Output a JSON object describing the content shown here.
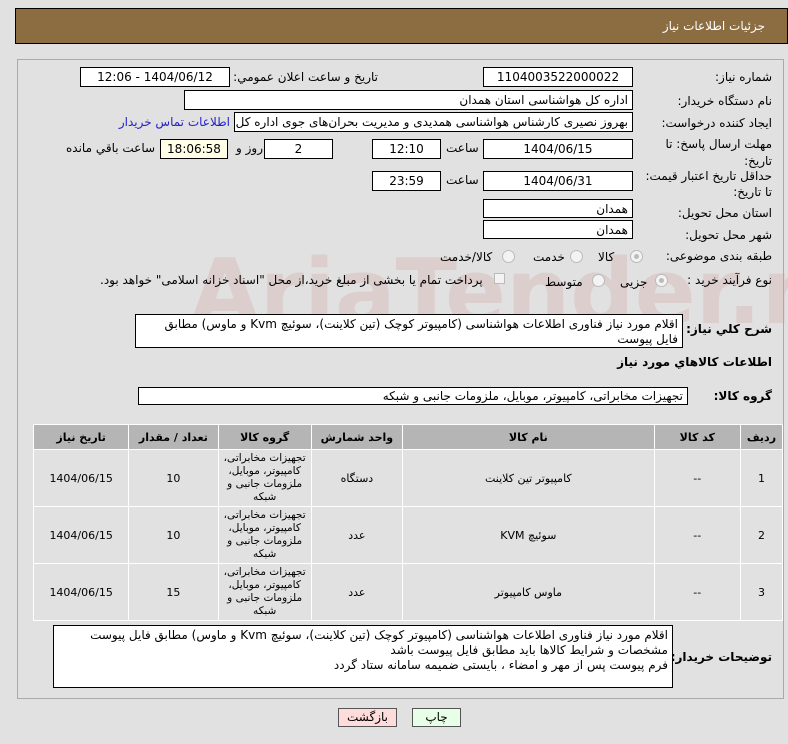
{
  "header": {
    "title": "جزئیات اطلاعات نیاز"
  },
  "form": {
    "need_number_label": "شماره نیاز:",
    "need_number": "1104003522000022",
    "announce_label": "تاریخ و ساعت اعلان عمومي:",
    "announce_value": "1404/06/12 - 12:06",
    "buyer_org_label": "نام دستگاه خریدار:",
    "buyer_org": "اداره کل هواشناسی استان همدان",
    "creator_label": "ایجاد کننده درخواست:",
    "creator": "بهروز نصیری کارشناس هواشناسی همدیدی و مدیریت بحران‌های جوی  اداره کل",
    "contact_link": "اطلاعات تماس خریدار",
    "deadline_label": "مهلت ارسال پاسخ: تا تاریخ:",
    "deadline_date": "1404/06/15",
    "time_label": "ساعت",
    "deadline_time": "12:10",
    "days": "2",
    "days_label": "روز و",
    "remaining": "18:06:58",
    "remaining_label": "ساعت باقي مانده",
    "validity_label": "حداقل تاریخ اعتبار قیمت: تا تاریخ:",
    "validity_date": "1404/06/31",
    "validity_time": "23:59",
    "province_label": "استان محل تحویل:",
    "province": "همدان",
    "city_label": "شهر محل تحویل:",
    "city": "همدان",
    "category_label": "طبقه بندی موضوعی:",
    "category_options": [
      "کالا",
      "خدمت",
      "کالا/خدمت"
    ],
    "process_label": "نوع فرآیند خرید :",
    "process_options": [
      "جزیی",
      "متوسط"
    ],
    "payment_note": "پرداخت تمام یا بخشی از مبلغ خرید،از محل \"اسناد خزانه اسلامی\" خواهد بود.",
    "description_label": "شرح كلي نياز:",
    "description": "اقلام مورد نیاز فناوری اطلاعات هواشناسی (کامپیوتر کوچک (تین کلاینت)، سوئیچ Kvm و ماوس) مطابق فایل پیوست"
  },
  "goods": {
    "section_title": "اطلاعات كالاهاي مورد نياز",
    "group_label": "گروه کالا:",
    "group": "تجهیزات مخابراتی، کامپیوتر، موبایل، ملزومات جانبی و شبکه",
    "columns": [
      "ردیف",
      "کد کالا",
      "نام کالا",
      "واحد شمارش",
      "گروه کالا",
      "تعداد / مقدار",
      "تاریخ نیاز"
    ],
    "rows": [
      {
        "idx": "1",
        "code": "--",
        "name": "کامپیوتر تین کلاینت",
        "unit": "دستگاه",
        "group": "تجهیزات مخابراتی، کامپیوتر، موبایل، ملزومات جانبی و شبکه",
        "qty": "10",
        "date": "1404/06/15"
      },
      {
        "idx": "2",
        "code": "--",
        "name": "سوئیچ KVM",
        "unit": "عدد",
        "group": "تجهیزات مخابراتی، کامپیوتر، موبایل، ملزومات جانبی و شبکه",
        "qty": "10",
        "date": "1404/06/15"
      },
      {
        "idx": "3",
        "code": "--",
        "name": "ماوس کامپیوتر",
        "unit": "عدد",
        "group": "تجهیزات مخابراتی، کامپیوتر، موبایل، ملزومات جانبی و شبکه",
        "qty": "15",
        "date": "1404/06/15"
      }
    ]
  },
  "notes": {
    "label": "توضیحات خریدار:",
    "lines": [
      "اقلام مورد نیاز فناوری اطلاعات هواشناسی (کامپیوتر کوچک (تین کلاینت)، سوئیچ Kvm و ماوس) مطابق فایل پیوست",
      "مشخصات و شرایط کالاها باید مطابق فایل پیوست باشد",
      "فرم پیوست پس از مهر و امضاء ، بایستی ضمیمه سامانه ستاد گردد"
    ]
  },
  "buttons": {
    "print": "چاپ",
    "back": "بازگشت"
  },
  "watermark": "AriaTender.net",
  "colors": {
    "header": "#8c6d42",
    "link": "#2222cc",
    "print_bg": "#e6ffe6",
    "back_bg": "#ffdcdc"
  }
}
